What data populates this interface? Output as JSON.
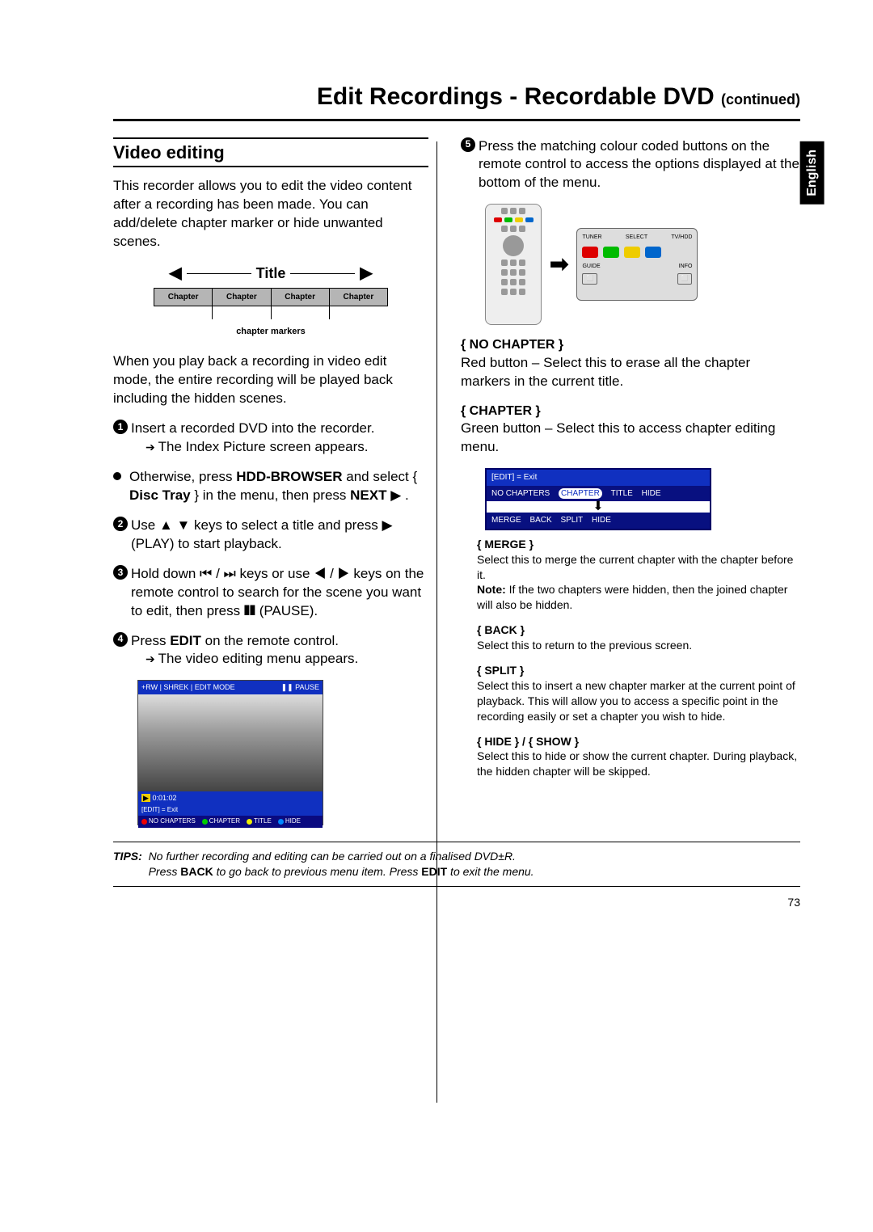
{
  "header": {
    "title_main": "Edit Recordings - Recordable DVD",
    "title_suffix": "(continued)"
  },
  "side_tab": "English",
  "page_number": "73",
  "left": {
    "heading": "Video editing",
    "intro": "This recorder allows you to edit the video content after a recording has been made. You can add/delete chapter marker or hide unwanted scenes.",
    "title_label": "Title",
    "chapter_label": "Chapter",
    "chapter_markers": "chapter markers",
    "playback_note": "When you play back a recording in video edit mode, the entire recording will be played back including the hidden scenes.",
    "step1": "Insert a recorded DVD into the recorder.",
    "step1_sub": "The Index Picture screen appears.",
    "step_bullet_a": "Otherwise, press ",
    "step_bullet_a_bold": "HDD-BROWSER",
    "step_bullet_b": " and select { ",
    "step_bullet_b_bold": "Disc Tray",
    "step_bullet_c": " } in the menu, then press ",
    "step_bullet_c_bold": "NEXT",
    "step_bullet_d": " ▶ .",
    "step2_a": "Use ▲ ▼ keys to select a title and press ▶ (PLAY) to start playback.",
    "step3_a": "Hold down ⏮ / ⏭ keys or use ◀ / ▶ keys on the remote control to search for the scene you want to edit, then press ❚❚ (PAUSE).",
    "step4_a": "Press ",
    "step4_bold": "EDIT",
    "step4_b": " on the remote control.",
    "step4_sub": "The video editing menu appears.",
    "screenshot": {
      "top_left": "+RW | SHREK | EDIT MODE",
      "top_right": "❚❚ PAUSE",
      "time": "0:01:02",
      "edit_exit": "[EDIT] = Exit",
      "opts": [
        "NO CHAPTERS",
        "CHAPTER",
        "TITLE",
        "HIDE"
      ]
    }
  },
  "right": {
    "step5": "Press the matching colour coded buttons on the remote control to access the options displayed at the bottom of the menu.",
    "zoom_labels": [
      "TUNER",
      "SELECT",
      "TV/HDD",
      "GUIDE",
      "INFO"
    ],
    "no_chapter_hdr": "{ NO CHAPTER }",
    "no_chapter_txt": "Red button – Select this to erase all the chapter markers in the current title.",
    "chapter_hdr": "{ CHAPTER }",
    "chapter_txt": "Green button – Select this to access chapter editing menu.",
    "menu_strip": {
      "exit": "[EDIT] = Exit",
      "row1": [
        "NO CHAPTERS",
        "CHAPTER",
        "TITLE",
        "HIDE"
      ],
      "row2": [
        "MERGE",
        "BACK",
        "SPLIT",
        "HIDE"
      ]
    },
    "merge_hdr": "{ MERGE }",
    "merge_txt": "Select this to merge the current chapter with the chapter before it.",
    "merge_note_lbl": "Note:",
    "merge_note": " If the two chapters were hidden, then the joined chapter will also be hidden.",
    "back_hdr": "{ BACK }",
    "back_txt": "Select this to return to the previous screen.",
    "split_hdr": "{ SPLIT }",
    "split_txt": "Select this to insert a new chapter marker at the current point of playback. This will allow you to access a specific point in the recording easily or set a chapter you wish to hide.",
    "hide_hdr": "{ HIDE } / { SHOW }",
    "hide_txt": "Select this to hide or show the current chapter. During playback, the hidden chapter will be skipped."
  },
  "tips": {
    "label": "TIPS:",
    "line1": "No further recording and editing can be carried out on a finalised DVD±R.",
    "line2a": "Press ",
    "line2b": "BACK",
    "line2c": " to go back to previous menu item. Press ",
    "line2d": "EDIT",
    "line2e": " to exit the menu."
  }
}
